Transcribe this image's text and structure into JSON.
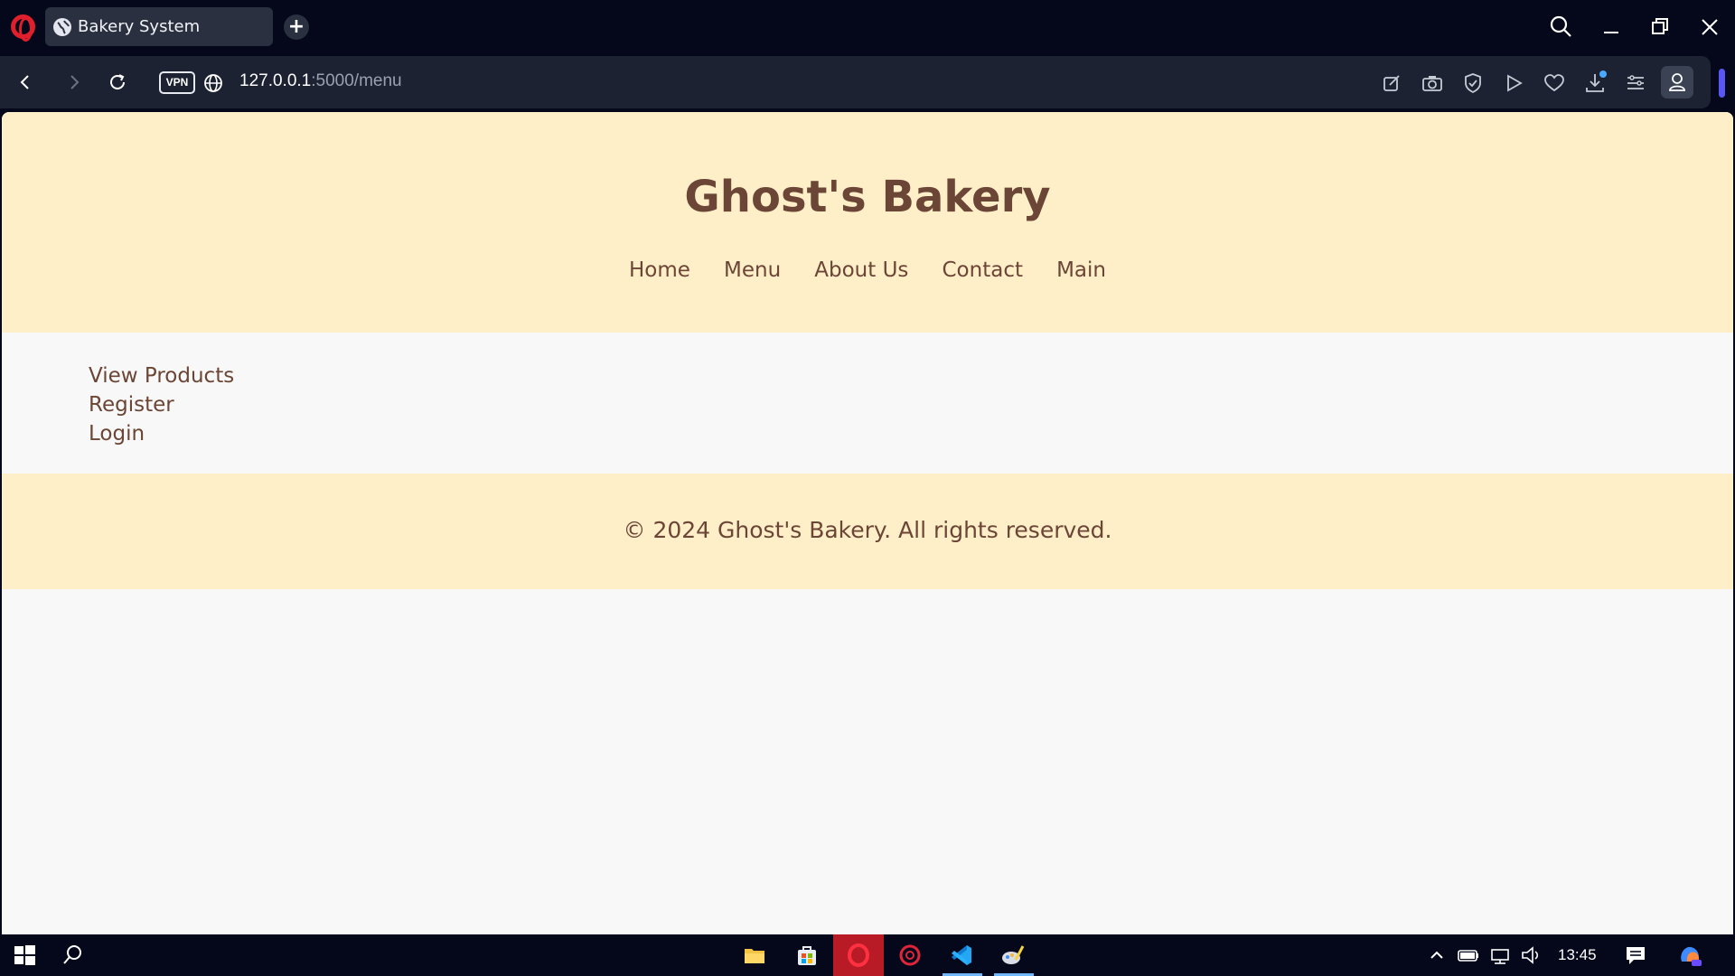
{
  "browser": {
    "tab_title": "Bakery System",
    "new_tab_label": "+",
    "vpn_label": "VPN",
    "url_host": "127.0.0.1",
    "url_path": ":5000/menu"
  },
  "site": {
    "title": "Ghost's Bakery",
    "nav": [
      "Home",
      "Menu",
      "About Us",
      "Contact",
      "Main"
    ],
    "links": [
      "View Products",
      "Register",
      "Login"
    ],
    "footer": "© 2024 Ghost's Bakery. All rights reserved."
  },
  "taskbar": {
    "clock": "13:45"
  },
  "colors": {
    "header_bg": "#ffefc9",
    "brand_text": "#6b4535",
    "page_bg": "#f8f8f8",
    "browser_bg": "#04081a",
    "accent": "#e01f2c"
  }
}
